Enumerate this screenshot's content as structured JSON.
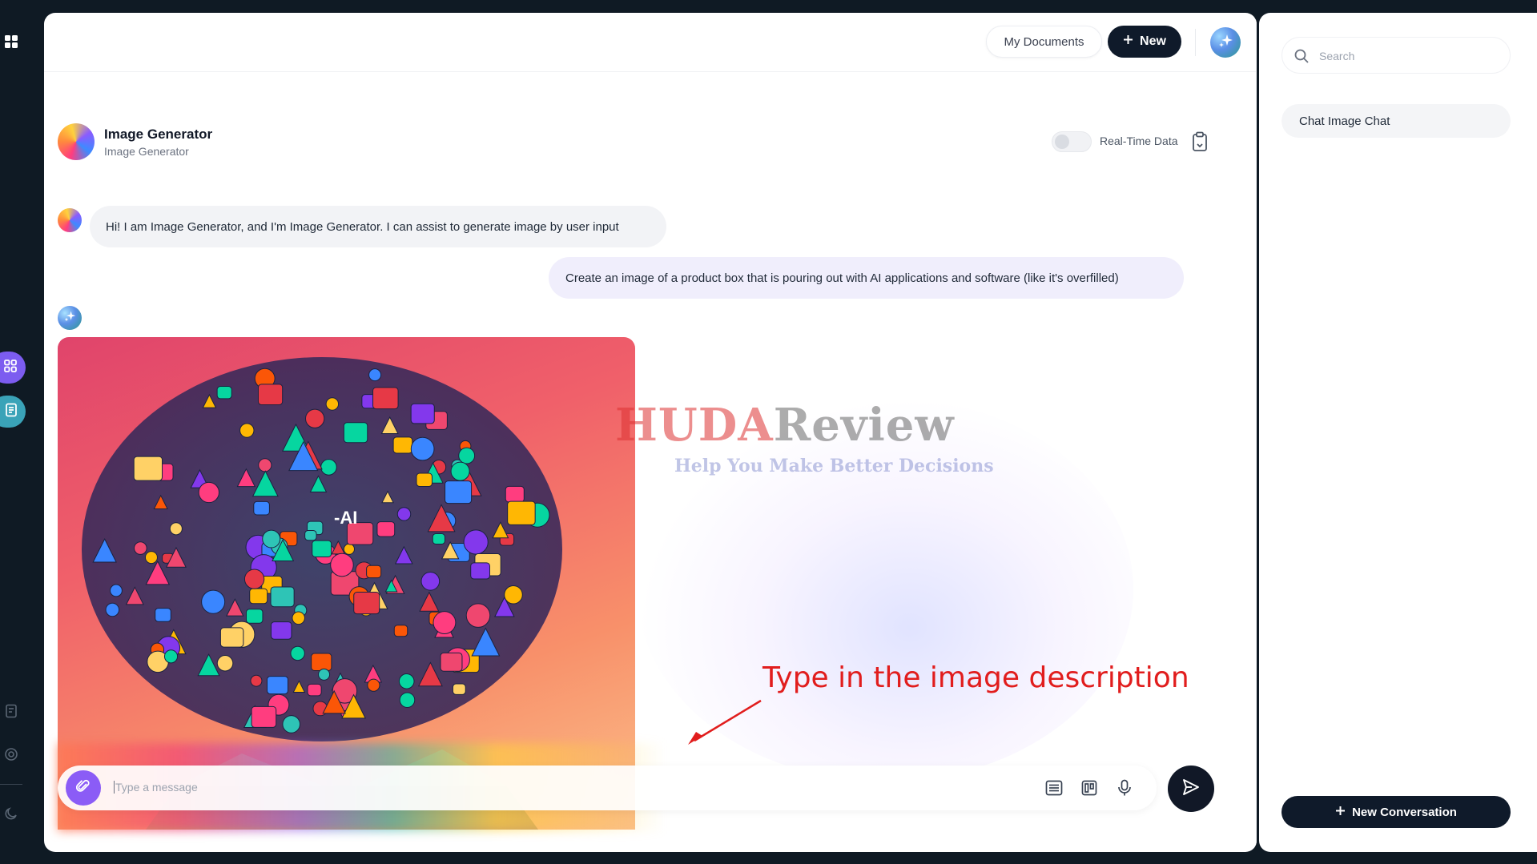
{
  "topbar": {
    "my_documents_label": "My Documents",
    "new_label": "New"
  },
  "assistant": {
    "name": "Image Generator",
    "subtitle": "Image Generator",
    "realtime_label": "Real-Time Data",
    "realtime_enabled": false
  },
  "messages": [
    {
      "role": "assistant",
      "text": "Hi! I am Image Generator, and I'm Image Generator. I can assist to generate image by user input"
    },
    {
      "role": "user",
      "text": "Create an image of a product box that is pouring out with AI applications and software (like it's overfilled)"
    }
  ],
  "generated_image": {
    "overlay_text": "-AI"
  },
  "watermark": {
    "brand_red": "HUDA",
    "brand_dark": "Review",
    "tagline": "Help You Make Better Decisions"
  },
  "annotation": {
    "text": "Type in the image description"
  },
  "composer": {
    "placeholder": "Type a message"
  },
  "right_panel": {
    "search_placeholder": "Search",
    "conversations": [
      "Chat Image Chat"
    ],
    "new_conversation_label": "New Conversation"
  },
  "colors": {
    "primary_dark": "#0f1a2a",
    "accent_purple": "#8b5cf6",
    "annotation_red": "#e11d1d",
    "user_bubble": "#f0eefc",
    "bot_bubble": "#f2f3f6"
  }
}
